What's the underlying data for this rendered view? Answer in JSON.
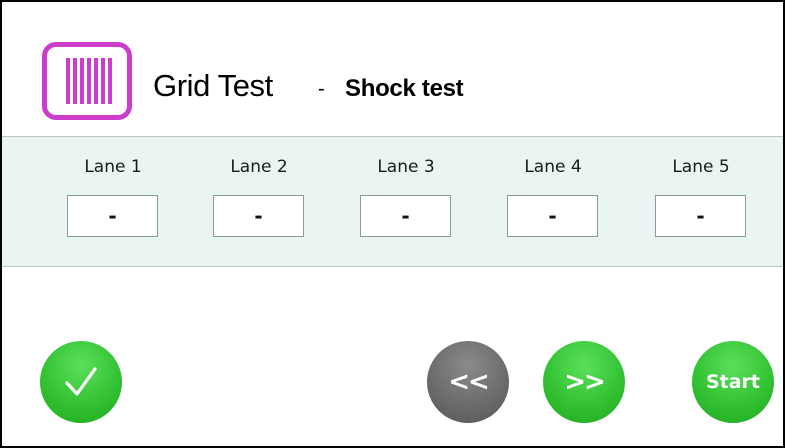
{
  "header": {
    "app_icon": "grid-icon",
    "title": "Grid Test",
    "separator": "-",
    "subtitle": "Shock test"
  },
  "lanes": [
    {
      "label": "Lane 1",
      "value": "-"
    },
    {
      "label": "Lane 2",
      "value": "-"
    },
    {
      "label": "Lane 3",
      "value": "-"
    },
    {
      "label": "Lane 4",
      "value": "-"
    },
    {
      "label": "Lane 5",
      "value": "-"
    }
  ],
  "buttons": {
    "confirm_icon": "checkmark-icon",
    "prev_label": "<<",
    "next_label": ">>",
    "start_label": "Start"
  },
  "colors": {
    "icon_border": "#cc3dcc",
    "band_background": "#eaf4f2",
    "button_green": "#33c233",
    "button_gray": "#6c6c6c"
  }
}
